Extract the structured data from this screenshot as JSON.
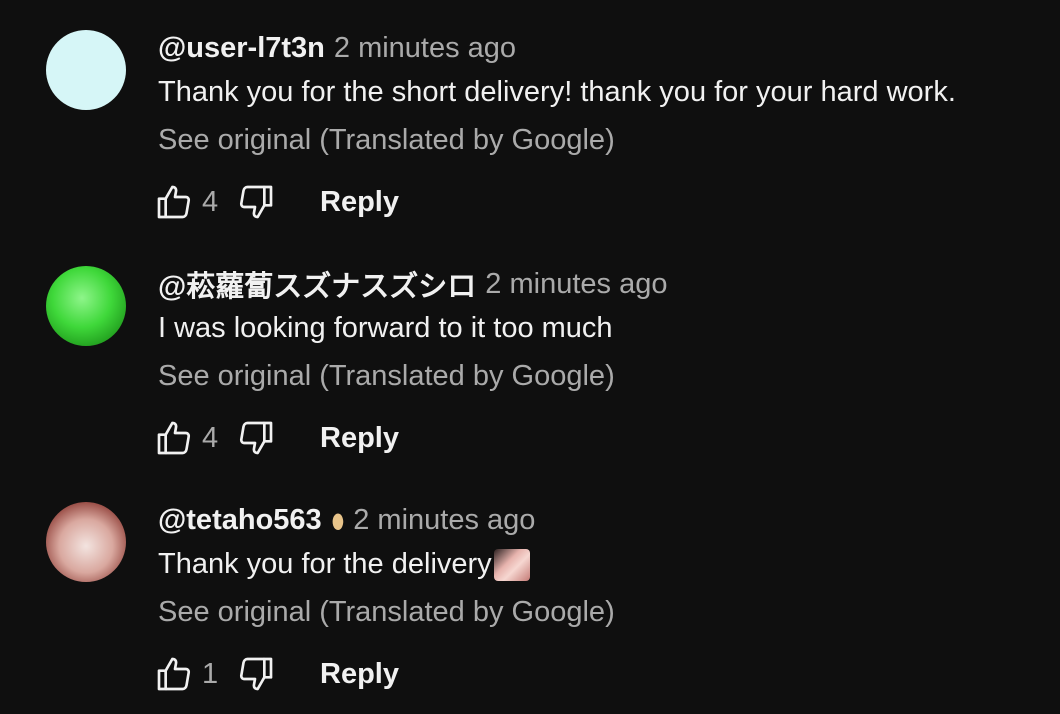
{
  "comments": [
    {
      "author": "@user-l7t3n",
      "time": "2 minutes ago",
      "text": "Thank you for the short delivery! thank you for your hard work.",
      "translate_label": "See original (Translated by Google)",
      "likes": "4",
      "reply_label": "Reply",
      "avatar": "plain-cyan-avatar"
    },
    {
      "author": "@菘蘿蔔スズナスズシロ",
      "time": "2 minutes ago",
      "text": "I was looking forward to it too much",
      "translate_label": "See original (Translated by Google)",
      "likes": "4",
      "reply_label": "Reply",
      "avatar": "green-dice-avatar"
    },
    {
      "author": "@tetaho563",
      "time": "2 minutes ago",
      "text": "Thank you for the delivery",
      "translate_label": "See original (Translated by Google)",
      "likes": "1",
      "reply_label": "Reply",
      "avatar": "anime-avatar",
      "badge_icon": "member-badge-icon",
      "emoji": "custom-emoji"
    }
  ],
  "colors": {
    "background": "#0f0f0f",
    "primary_text": "#f1f1f1",
    "secondary_text": "#aaaaaa"
  }
}
